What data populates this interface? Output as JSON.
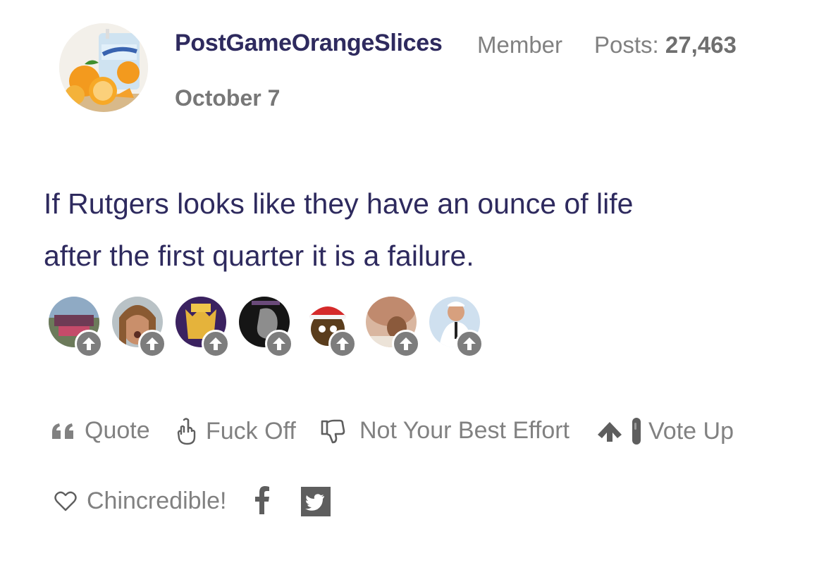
{
  "post": {
    "author": "PostGameOrangeSlices",
    "role": "Member",
    "posts_label": "Posts:",
    "posts_count": "27,463",
    "date": "October 7",
    "body_lines": [
      "If Rutgers looks like they have an ounce of life",
      "after the first quarter it is a failure."
    ]
  },
  "reactors": [
    {
      "name": "reactor-avatar-1",
      "icon": "vote-up-icon"
    },
    {
      "name": "reactor-avatar-2",
      "icon": "vote-up-icon"
    },
    {
      "name": "reactor-avatar-3",
      "icon": "vote-up-icon"
    },
    {
      "name": "reactor-avatar-4",
      "icon": "vote-up-icon"
    },
    {
      "name": "reactor-avatar-5",
      "icon": "vote-up-icon"
    },
    {
      "name": "reactor-avatar-6",
      "icon": "vote-up-icon"
    },
    {
      "name": "reactor-avatar-7",
      "icon": "vote-up-icon"
    }
  ],
  "reactions": {
    "quote": "Quote",
    "fuck_off": "Fuck Off",
    "not_best_effort": "Not Your Best Effort",
    "vote_up": "Vote Up",
    "chincredible": "Chincredible!"
  },
  "colors": {
    "author": "#2e2a5e",
    "body": "#2e2a5e",
    "muted": "#818181"
  }
}
